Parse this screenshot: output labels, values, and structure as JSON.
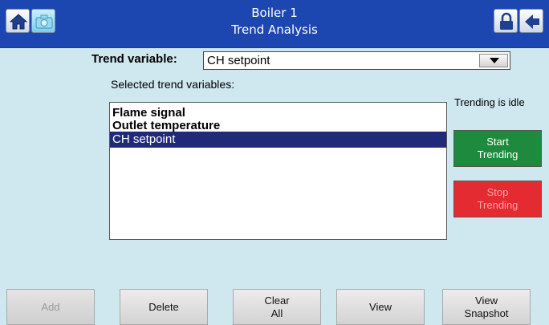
{
  "header": {
    "title_line1": "Boiler 1",
    "title_line2": "Trend Analysis",
    "icons": {
      "home": "home-icon",
      "snapshot": "camera-icon",
      "lock": "lock-icon",
      "back": "back-arrow-icon"
    }
  },
  "trend_variable": {
    "label": "Trend variable:",
    "selected_value": "CH setpoint"
  },
  "selected_list": {
    "label": "Selected trend variables:",
    "items": [
      "Flame signal",
      "Outlet temperature",
      "CH setpoint"
    ],
    "selected_index": 2
  },
  "status": {
    "text": "Trending is idle"
  },
  "side_buttons": {
    "start_line1": "Start",
    "start_line2": "Trending",
    "stop_line1": "Stop",
    "stop_line2": "Trending"
  },
  "bottom_buttons": {
    "add": "Add",
    "delete": "Delete",
    "clear_line1": "Clear",
    "clear_line2": "All",
    "view": "View",
    "snapshot_line1": "View",
    "snapshot_line2": "Snapshot"
  },
  "colors": {
    "background": "#cfe7ef",
    "header": "#1c47b0",
    "start_button": "#1e8a3e",
    "stop_button": "#e52b32",
    "selection": "#1f2a78"
  }
}
